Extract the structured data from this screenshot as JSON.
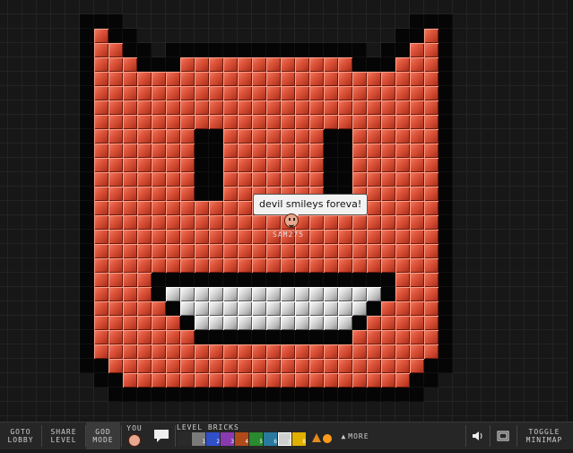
{
  "game": {
    "chat_message": "devil smileys foreva!",
    "player_name": "SAM275"
  },
  "toolbar": {
    "goto_lobby": [
      "GOTO",
      "LOBBY"
    ],
    "share_level": [
      "SHARE",
      "LEVEL"
    ],
    "god_mode": [
      "GOD",
      "MODE"
    ],
    "you_label": "YOU",
    "level_bricks_label": "LEVEL BRICKS",
    "more_label": "MORE",
    "toggle_minimap": [
      "TOGGLE",
      "MINIMAP"
    ],
    "brick_numbers": [
      "1",
      "2",
      "3",
      "4",
      "5",
      "6",
      "7",
      "8"
    ],
    "colors": {
      "accent_red": "#e0593f",
      "toolbar_bg": "#262626"
    },
    "icons": [
      "chat-icon",
      "sound-icon",
      "fullscreen-icon",
      "smiley-icon",
      "more-arrow-icon"
    ]
  }
}
